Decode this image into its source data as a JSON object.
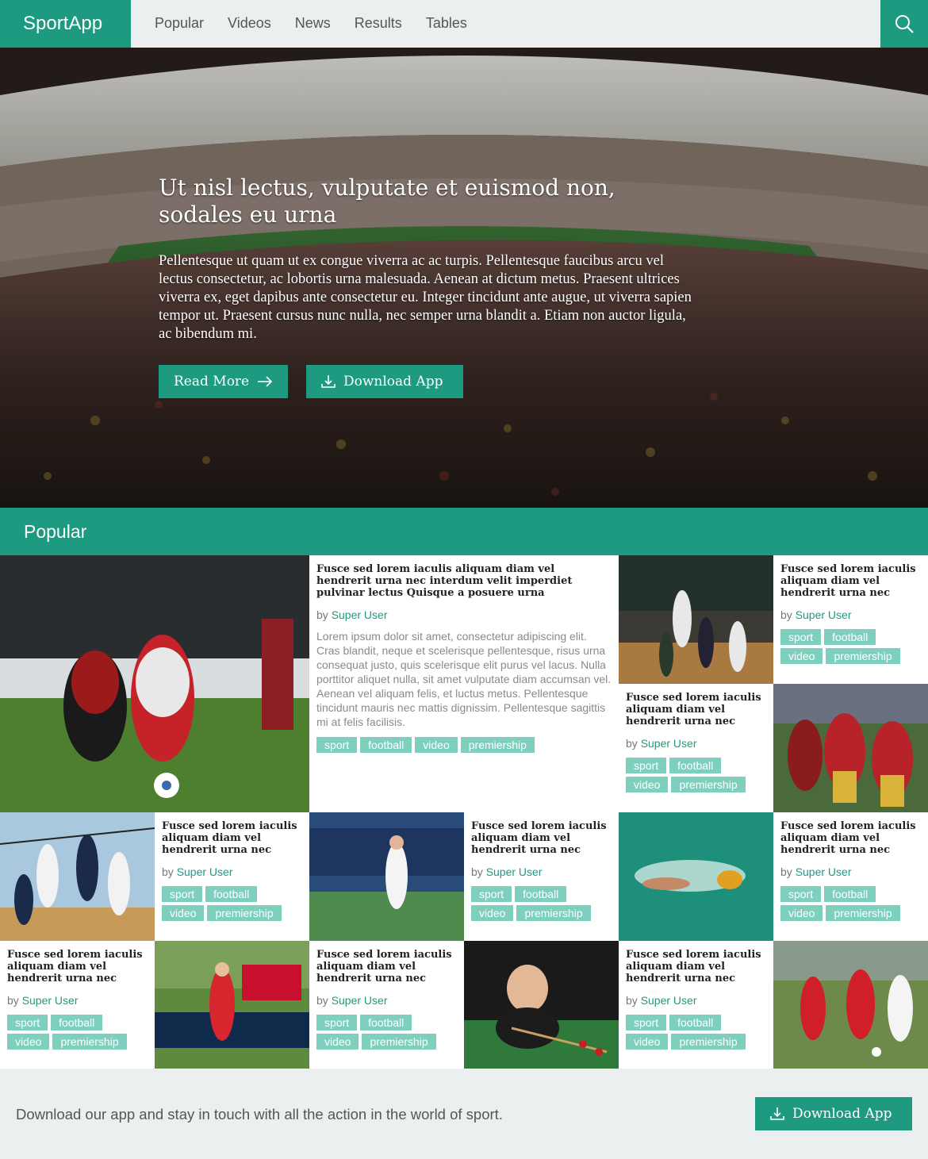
{
  "brand": "SportApp",
  "nav": [
    "Popular",
    "Videos",
    "News",
    "Results",
    "Tables"
  ],
  "hero": {
    "title": "Ut nisl lectus, vulputate et euismod non, sodales eu urna",
    "body": "Pellentesque ut quam ut ex congue viverra ac ac turpis. Pellentesque faucibus arcu vel lectus consectetur, ac lobortis urna malesuada. Aenean at dictum metus. Praesent ultrices viverra ex, eget dapibus ante consectetur eu. Integer tincidunt ante augue, ut viverra sapien tempor ut. Praesent cursus nunc nulla, nec semper urna blandit a. Etiam non auctor ligula, ac bibendum mi.",
    "read_more": "Read More",
    "download": "Download App"
  },
  "popular": {
    "heading": "Popular"
  },
  "featured": {
    "title": "Fusce sed lorem iaculis aliquam diam vel hendrerit urna nec interdum velit imperdiet pulvinar lectus Quisque a posuere urna",
    "by": "by",
    "author": "Super User",
    "desc": "Lorem ipsum dolor sit amet, consectetur adipiscing elit. Cras blandit, neque et scelerisque pellentesque, risus urna consequat justo, quis scelerisque elit purus vel lacus. Nulla porttitor aliquet nulla, sit amet vulputate diam accumsan vel. Aenean vel aliquam felis, et luctus metus. Pellentesque tincidunt mauris nec mattis dignissim. Pellentesque sagittis mi at felis facilisis.",
    "tags": [
      "sport",
      "football",
      "video",
      "premiership"
    ]
  },
  "card": {
    "title": "Fusce sed lorem iaculis aliquam diam vel hendrerit urna nec",
    "by": "by",
    "author": "Super User",
    "tags": [
      "sport",
      "football",
      "video",
      "premiership"
    ]
  },
  "footer": {
    "text": "Download our app and stay in touch with all the action in the world of sport.",
    "download": "Download App"
  },
  "colors": {
    "accent": "#1d9a80",
    "tag": "#7fcfbe"
  }
}
